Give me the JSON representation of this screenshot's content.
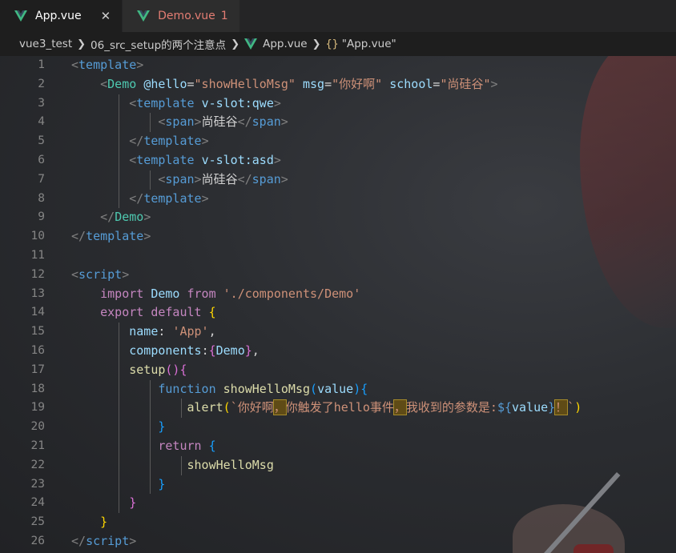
{
  "tabs": [
    {
      "label": "App.vue",
      "active": true,
      "close": "✕"
    },
    {
      "label": "Demo.vue",
      "active": false,
      "count": "1"
    }
  ],
  "breadcrumb": {
    "items": [
      "vue3_test",
      "06_src_setup的两个注意点",
      "App.vue"
    ],
    "symbol_braces": "{}",
    "symbol_label": "\"App.vue\""
  },
  "colors": {
    "accent_vue": "#41b883",
    "tab_modified": "#e37d73"
  },
  "line_numbers": [
    "1",
    "2",
    "3",
    "4",
    "5",
    "6",
    "7",
    "8",
    "9",
    "10",
    "11",
    "12",
    "13",
    "14",
    "15",
    "16",
    "17",
    "18",
    "19",
    "20",
    "21",
    "22",
    "23",
    "24",
    "25",
    "26"
  ],
  "code": {
    "l1": {
      "open": "<",
      "tag": "template",
      "close": ">"
    },
    "l2": {
      "open": "<",
      "comp": "Demo",
      "a1": "@hello",
      "eq1": "=",
      "v1": "\"showHelloMsg\"",
      "a2": "msg",
      "eq2": "=",
      "v2": "\"你好啊\"",
      "a3": "school",
      "eq3": "=",
      "v3": "\"尚硅谷\"",
      "close": ">"
    },
    "l3": {
      "open": "<",
      "tag": "template",
      "attr": "v-slot:qwe",
      "close": ">"
    },
    "l4": {
      "open": "<",
      "tag": "span",
      "close": ">",
      "text": "尚硅谷",
      "endopen": "</",
      "endtag": "span",
      "endclose": ">"
    },
    "l5": {
      "open": "</",
      "tag": "template",
      "close": ">"
    },
    "l6": {
      "open": "<",
      "tag": "template",
      "attr": "v-slot:asd",
      "close": ">"
    },
    "l7": {
      "open": "<",
      "tag": "span",
      "close": ">",
      "text": "尚硅谷",
      "endopen": "</",
      "endtag": "span",
      "endclose": ">"
    },
    "l8": {
      "open": "</",
      "tag": "template",
      "close": ">"
    },
    "l9": {
      "open": "</",
      "comp": "Demo",
      "close": ">"
    },
    "l10": {
      "open": "</",
      "tag": "template",
      "close": ">"
    },
    "l12": {
      "open": "<",
      "tag": "script",
      "close": ">"
    },
    "l13": {
      "kw1": "import",
      "name": "Demo",
      "kw2": "from",
      "path": "'./components/Demo'"
    },
    "l14": {
      "kw1": "export",
      "kw2": "default",
      "brace": "{"
    },
    "l15": {
      "key": "name",
      "colon": ":",
      "val": "'App'",
      "comma": ","
    },
    "l16": {
      "key": "components",
      "colon": ":",
      "b_open": "{",
      "val": "Demo",
      "b_close": "}",
      "comma": ","
    },
    "l17": {
      "fn": "setup",
      "parens": "()",
      "brace": "{"
    },
    "l18": {
      "kw": "function",
      "fn": "showHelloMsg",
      "p_open": "(",
      "param": "value",
      "p_close": ")",
      "brace": "{"
    },
    "l19": {
      "fn": "alert",
      "p_open": "(",
      "s1": "`你好啊",
      "h1": "，",
      "s2": "你触发了hello事件",
      "h2": "，",
      "s3": "我收到的参数是:",
      "interp_open": "${",
      "var": "value",
      "interp_close": "}",
      "h3": "！",
      "s4": "`",
      "p_close": ")"
    },
    "l20": {
      "brace": "}"
    },
    "l21": {
      "kw": "return",
      "brace": "{"
    },
    "l22": {
      "val": "showHelloMsg"
    },
    "l23": {
      "brace": "}"
    },
    "l24": {
      "brace": "}"
    },
    "l25": {
      "brace": "}"
    },
    "l26": {
      "open": "</",
      "tag": "script",
      "close": ">"
    }
  }
}
